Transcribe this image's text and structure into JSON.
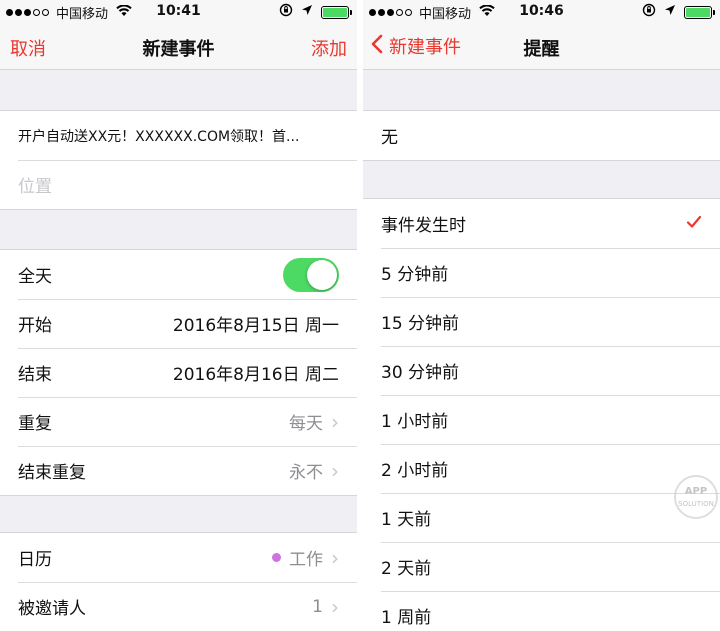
{
  "left": {
    "status": {
      "carrier": "中国移动",
      "time": "10:41"
    },
    "nav": {
      "cancel": "取消",
      "title": "新建事件",
      "add": "添加"
    },
    "event": {
      "title": "开户自动送XX元！XXXXXX.COM领取！首...",
      "location_placeholder": "位置"
    },
    "all_day": {
      "label": "全天",
      "on": true
    },
    "start": {
      "label": "开始",
      "value": "2016年8月15日 周一"
    },
    "end": {
      "label": "结束",
      "value": "2016年8月16日 周二"
    },
    "repeat": {
      "label": "重复",
      "value": "每天"
    },
    "end_repeat": {
      "label": "结束重复",
      "value": "永不"
    },
    "calendar": {
      "label": "日历",
      "value": "工作",
      "color": "#cc73e1"
    },
    "invitees": {
      "label": "被邀请人",
      "value": "1"
    }
  },
  "right": {
    "status": {
      "carrier": "中国移动",
      "time": "10:46"
    },
    "nav": {
      "back": "新建事件",
      "title": "提醒"
    },
    "none_option": "无",
    "options": [
      "事件发生时",
      "5 分钟前",
      "15 分钟前",
      "30 分钟前",
      "1 小时前",
      "2 小时前",
      "1 天前",
      "2 天前",
      "1 周前"
    ],
    "selected_index": 0,
    "watermark": {
      "line1": "APP",
      "line2": "SOLUTION"
    }
  },
  "colors": {
    "accent": "#e8382f",
    "toggle_on": "#4cd964",
    "battery": "#4cd964"
  },
  "icons": [
    "signal-dots-icon",
    "wifi-icon",
    "orientation-lock-icon",
    "location-arrow-icon",
    "battery-icon",
    "chevron-right-icon",
    "chevron-left-icon",
    "checkmark-icon"
  ]
}
